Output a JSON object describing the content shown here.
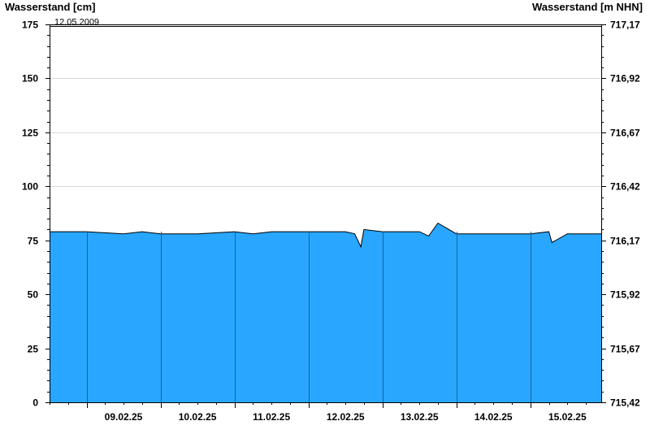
{
  "chart_data": {
    "type": "area",
    "y_left_label": "Wasserstand [cm]",
    "y_right_label": "Wasserstand [m NHN]",
    "reference_date_label": "12.05.2009",
    "ylim": [
      0,
      175
    ],
    "y_ticks": [
      0,
      25,
      50,
      75,
      100,
      125,
      150,
      175
    ],
    "y_right_ticks": [
      "715,42",
      "715,67",
      "715,92",
      "716,17",
      "716,42",
      "716,67",
      "716,92",
      "717,17"
    ],
    "reference_level": 175,
    "x_start": "2025-02-08T12:00",
    "x_end": "2025-02-15T23:00",
    "x_tick_labels": [
      "09.02.25",
      "10.02.25",
      "11.02.25",
      "12.02.25",
      "13.02.25",
      "14.02.25",
      "15.02.25"
    ],
    "x": [
      "2025-02-08T12:00",
      "2025-02-09T00:00",
      "2025-02-09T12:00",
      "2025-02-09T18:00",
      "2025-02-10T00:00",
      "2025-02-10T12:00",
      "2025-02-11T00:00",
      "2025-02-11T06:00",
      "2025-02-11T12:00",
      "2025-02-12T00:00",
      "2025-02-12T06:00",
      "2025-02-12T12:00",
      "2025-02-12T15:00",
      "2025-02-12T17:00",
      "2025-02-12T18:00",
      "2025-02-13T00:00",
      "2025-02-13T09:00",
      "2025-02-13T12:00",
      "2025-02-13T15:00",
      "2025-02-13T18:00",
      "2025-02-14T00:00",
      "2025-02-14T12:00",
      "2025-02-15T00:00",
      "2025-02-15T06:00",
      "2025-02-15T07:00",
      "2025-02-15T12:00",
      "2025-02-15T23:00"
    ],
    "y": [
      79,
      79,
      78,
      79,
      78,
      78,
      79,
      78,
      79,
      79,
      79,
      79,
      78,
      72,
      80,
      79,
      79,
      79,
      77,
      83,
      78,
      78,
      78,
      79,
      74,
      78,
      78
    ],
    "color": "#29a6ff",
    "grid": true
  }
}
